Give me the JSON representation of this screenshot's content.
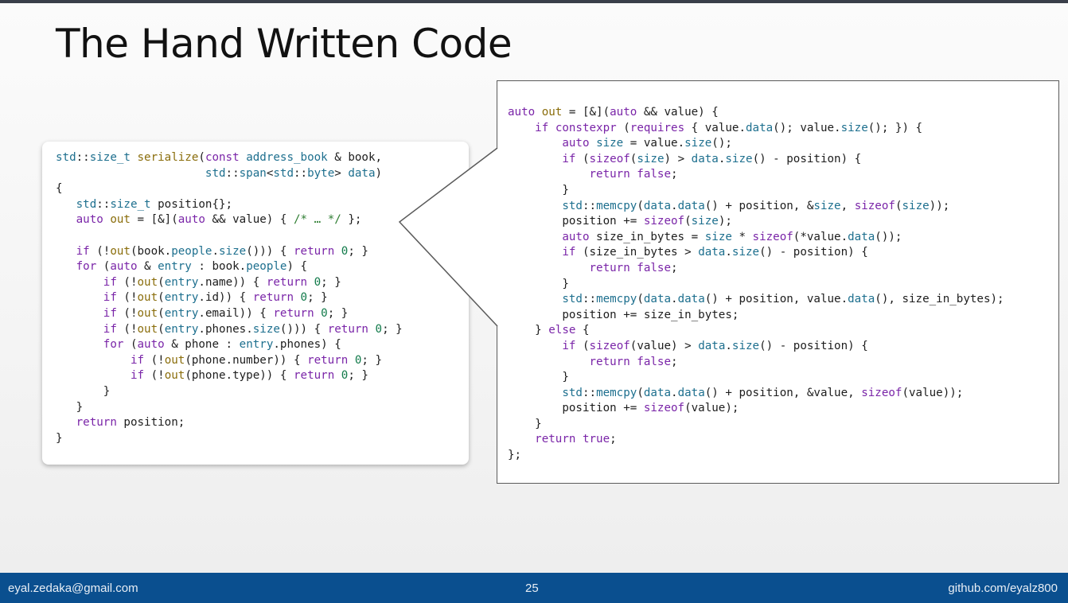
{
  "slide": {
    "title": "The Hand Written Code"
  },
  "left_code": {
    "lines": [
      "std::size_t serialize(const address_book & book,",
      "                      std::span<std::byte> data)",
      "{",
      "   std::size_t position{};",
      "   auto out = [&](auto && value) { /* … */ };",
      "",
      "   if (!out(book.people.size())) { return 0; }",
      "   for (auto & entry : book.people) {",
      "       if (!out(entry.name)) { return 0; }",
      "       if (!out(entry.id)) { return 0; }",
      "       if (!out(entry.email)) { return 0; }",
      "       if (!out(entry.phones.size())) { return 0; }",
      "       for (auto & phone : entry.phones) {",
      "           if (!out(phone.number)) { return 0; }",
      "           if (!out(phone.type)) { return 0; }",
      "       }",
      "   }",
      "   return position;",
      "}"
    ]
  },
  "right_code": {
    "lines": [
      "auto out = [&](auto && value) {",
      "    if constexpr (requires { value.data(); value.size(); }) {",
      "        auto size = value.size();",
      "        if (sizeof(size) > data.size() - position) {",
      "            return false;",
      "        }",
      "        std::memcpy(data.data() + position, &size, sizeof(size));",
      "        position += sizeof(size);",
      "        auto size_in_bytes = size * sizeof(*value.data());",
      "        if (size_in_bytes > data.size() - position) {",
      "            return false;",
      "        }",
      "        std::memcpy(data.data() + position, value.data(), size_in_bytes);",
      "        position += size_in_bytes;",
      "    } else {",
      "        if (sizeof(value) > data.size() - position) {",
      "            return false;",
      "        }",
      "        std::memcpy(data.data() + position, &value, sizeof(value));",
      "        position += sizeof(value);",
      "    }",
      "    return true;",
      "};"
    ]
  },
  "footer": {
    "email": "eyal.zedaka@gmail.com",
    "page_number": "25",
    "github": "github.com/eyalz800"
  },
  "colors": {
    "footer_bg": "#0a4f8f",
    "keyword": "#7a25a8",
    "type": "#1d6f8e",
    "function": "#8a6d0b",
    "number": "#117a4a",
    "comment": "#2e7d32"
  }
}
